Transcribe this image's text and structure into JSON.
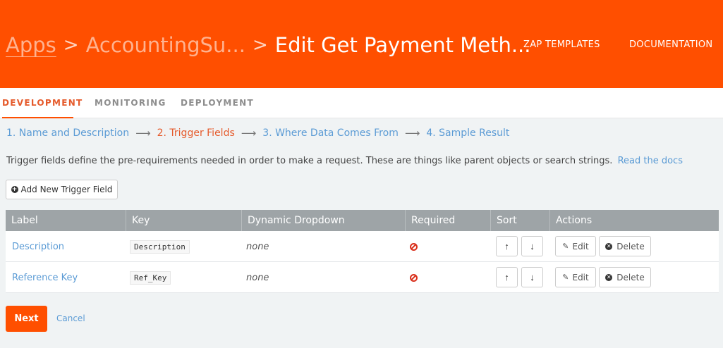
{
  "header": {
    "breadcrumb": {
      "apps": "Apps",
      "app": "AccountingSu...",
      "current": "Edit Get Payment Meth...",
      "separator": ">"
    },
    "links": {
      "zap_templates": "ZAP TEMPLATES",
      "documentation": "DOCUMENTATION"
    },
    "accent_color": "#ff4f00"
  },
  "tabs": {
    "development": "DEVELOPMENT",
    "monitoring": "MONITORING",
    "deployment": "DEPLOYMENT",
    "active": "DEVELOPMENT"
  },
  "steps": {
    "step1": "1. Name and Description",
    "step2": "2. Trigger Fields",
    "step3": "3. Where Data Comes From",
    "step4": "4. Sample Result",
    "arrow": "⟶",
    "current": "2. Trigger Fields"
  },
  "description": {
    "text": "Trigger fields define the pre-requirements needed in order to make a request. These are things like parent objects or search strings.",
    "link": "Read the docs"
  },
  "add_button": {
    "label": "Add New Trigger Field",
    "icon": "plus-circle-icon"
  },
  "table": {
    "headers": {
      "label": "Label",
      "key": "Key",
      "dynamic": "Dynamic Dropdown",
      "required": "Required",
      "sort": "Sort",
      "actions": "Actions"
    },
    "rows": [
      {
        "label": "Description",
        "key": "Description",
        "dynamic": "none",
        "required": false,
        "edit": "Edit",
        "delete": "Delete"
      },
      {
        "label": "Reference Key",
        "key": "Ref_Key",
        "dynamic": "none",
        "required": false,
        "edit": "Edit",
        "delete": "Delete"
      }
    ]
  },
  "footer": {
    "next": "Next",
    "cancel": "Cancel"
  }
}
